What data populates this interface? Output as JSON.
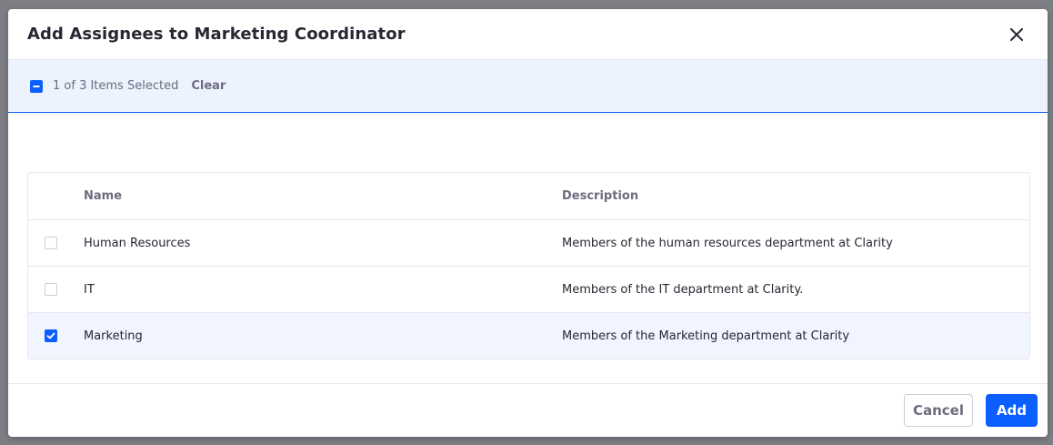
{
  "modal": {
    "title": "Add Assignees to Marketing Coordinator",
    "close_icon": "close-icon"
  },
  "management_bar": {
    "status": "1 of 3 Items Selected",
    "clear_label": "Clear",
    "select_all_state": "indeterminate"
  },
  "table": {
    "columns": [
      "Name",
      "Description"
    ],
    "rows": [
      {
        "name": "Human Resources",
        "description": "Members of the human resources department at Clarity",
        "checked": false
      },
      {
        "name": "IT",
        "description": "Members of the IT department at Clarity.",
        "checked": false
      },
      {
        "name": "Marketing",
        "description": "Members of the Marketing department at Clarity",
        "checked": true
      }
    ]
  },
  "footer": {
    "cancel_label": "Cancel",
    "add_label": "Add"
  },
  "colors": {
    "primary": "#0b5fff",
    "selected_row": "#f0f5ff",
    "management_bar_bg": "#edf3fe"
  }
}
